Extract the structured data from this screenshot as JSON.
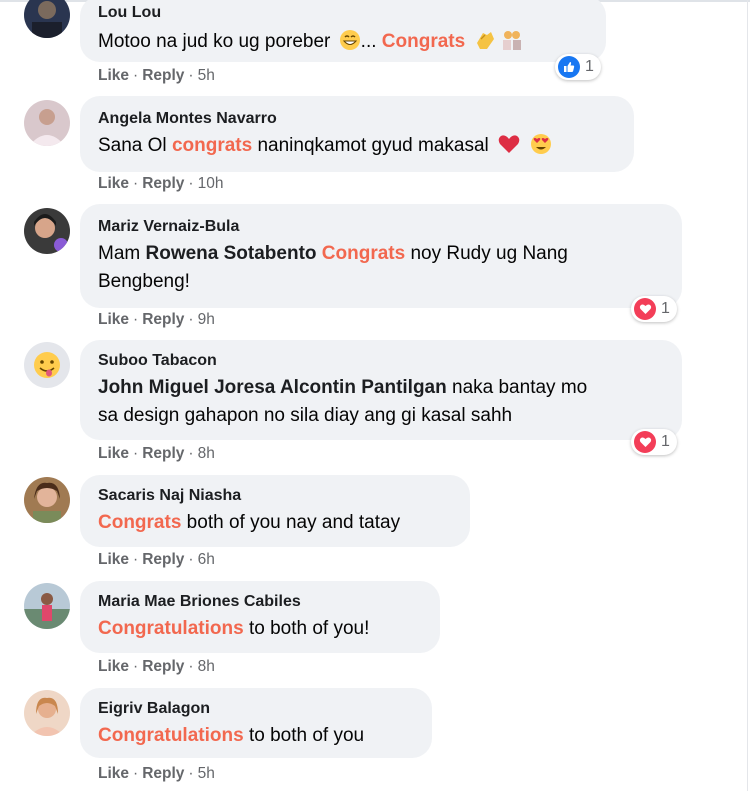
{
  "comments": [
    {
      "author": "Lou Lou",
      "text_pre": "Motoo na jud ko ug poreber ",
      "text_mid": "... ",
      "keyword": "Congrats",
      "emojis": [
        "grin-emoji",
        "clap-emoji",
        "couple-emoji"
      ],
      "actions": {
        "like": "Like",
        "reply": "Reply",
        "time": "5h"
      },
      "reaction": {
        "type": "like-reaction-icon",
        "count": "1"
      }
    },
    {
      "author": "Angela Montes Navarro",
      "text_pre": "Sana Ol ",
      "keyword": "congrats",
      "text_post": " naninqkamot gyud makasal",
      "emojis": [
        "red-heart-emoji",
        "heart-eyes-emoji"
      ],
      "actions": {
        "like": "Like",
        "reply": "Reply",
        "time": "10h"
      }
    },
    {
      "author": "Mariz Vernaiz-Bula",
      "text_pre": "Mam ",
      "tag": "Rowena Sotabento",
      "keyword": "Congrats",
      "text_post": " noy Rudy ug Nang",
      "text_line2": "Bengbeng!",
      "actions": {
        "like": "Like",
        "reply": "Reply",
        "time": "9h"
      },
      "reaction": {
        "type": "love-reaction-icon",
        "count": "1"
      }
    },
    {
      "author": "Suboo Tabacon",
      "tag": "John Miguel Joresa Alcontin Pantilgan",
      "text_post": " naka bantay mo",
      "text_line2": "sa design gahapon no sila diay ang gi kasal sahh",
      "actions": {
        "like": "Like",
        "reply": "Reply",
        "time": "8h"
      },
      "reaction": {
        "type": "love-reaction-icon",
        "count": "1"
      }
    },
    {
      "author": "Sacaris Naj Niasha",
      "keyword": "Congrats",
      "text_post": " both of you nay and tatay",
      "actions": {
        "like": "Like",
        "reply": "Reply",
        "time": "6h"
      }
    },
    {
      "author": "Maria Mae Briones Cabiles",
      "keyword": "Congratulations",
      "text_post": " to both of you!",
      "actions": {
        "like": "Like",
        "reply": "Reply",
        "time": "8h"
      }
    },
    {
      "author": "Eigriv Balagon",
      "keyword": "Congratulations",
      "text_post": " to both of you",
      "actions": {
        "like": "Like",
        "reply": "Reply",
        "time": "5h"
      }
    }
  ],
  "colors": {
    "keyword": "#f2684f",
    "bubble": "#f0f2f5",
    "meta": "#65676b",
    "like_blue": "#1877f2",
    "love_red": "#f33e58"
  }
}
